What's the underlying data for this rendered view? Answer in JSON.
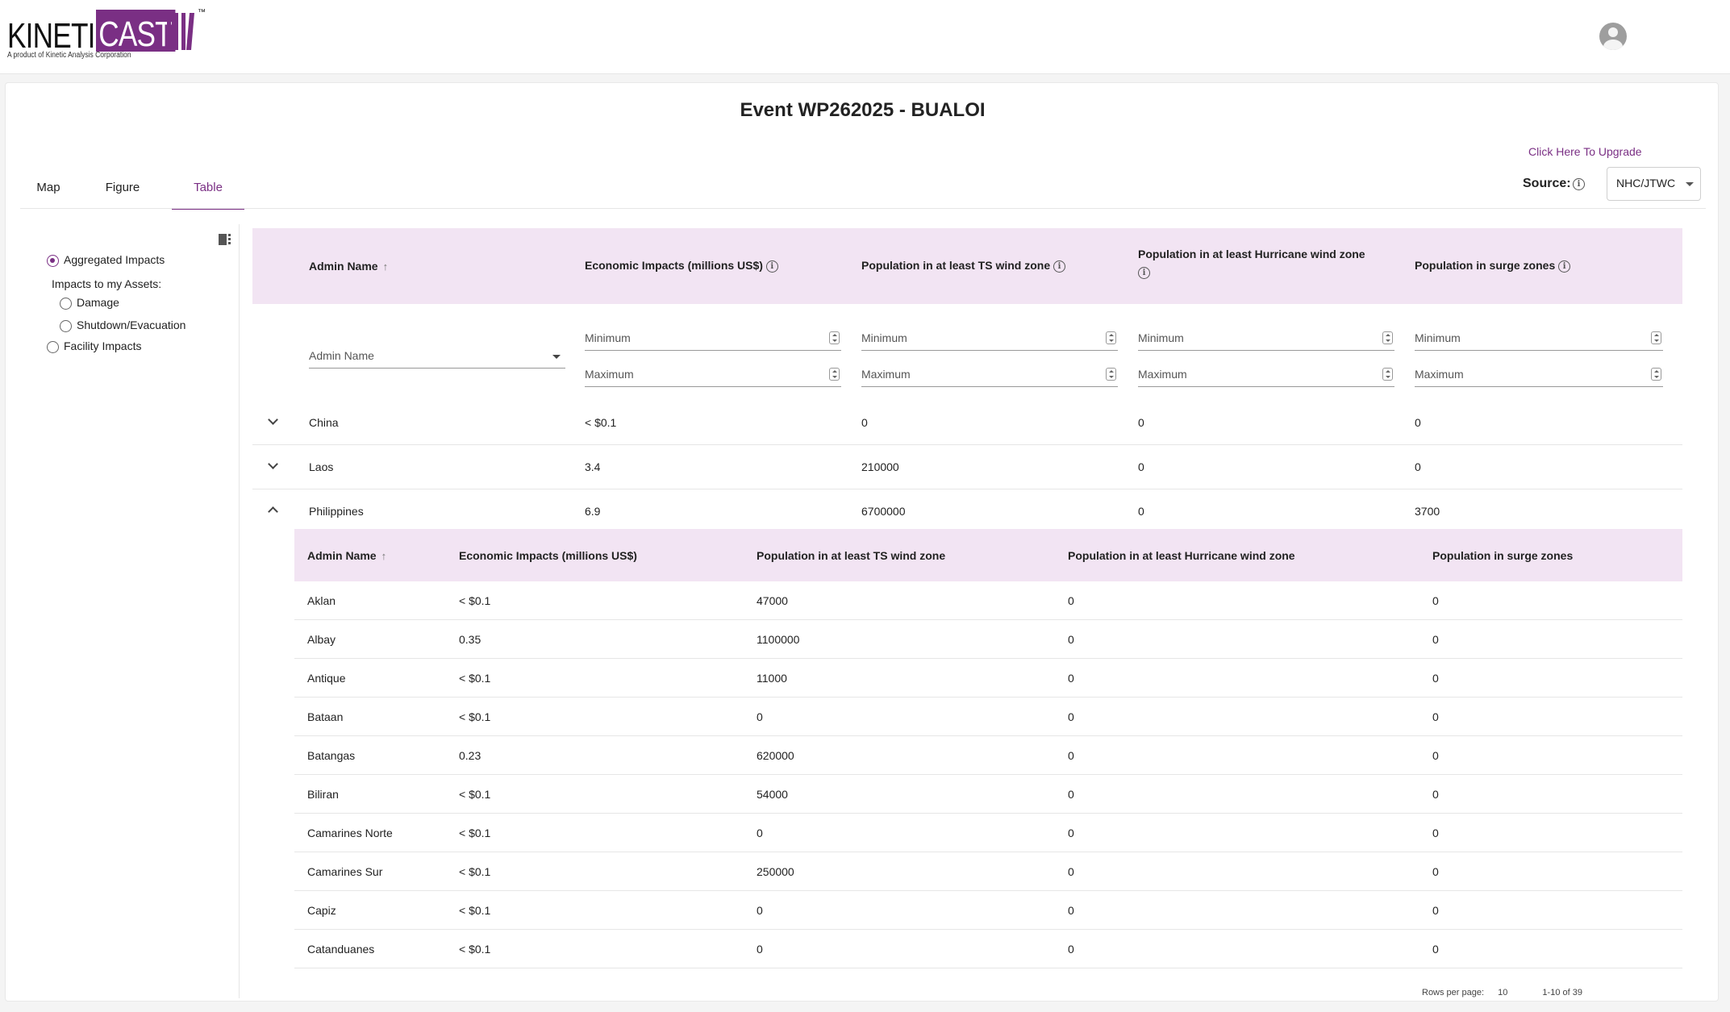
{
  "brand": {
    "name_left": "KINETI",
    "name_right": "CAST",
    "tm": "™",
    "tagline": "A product of Kinetic Analysis Corporation"
  },
  "page": {
    "title": "Event WP262025 - BUALOI",
    "upgrade_link": "Click Here To Upgrade"
  },
  "source": {
    "label": "Source:",
    "value": "NHC/JTWC"
  },
  "tabs": [
    {
      "label": "Map"
    },
    {
      "label": "Figure"
    },
    {
      "label": "Table"
    }
  ],
  "sidebar": {
    "aggregated": "Aggregated Impacts",
    "assets_label": "Impacts to my Assets:",
    "damage": "Damage",
    "shutdown": "Shutdown/Evacuation",
    "facility": "Facility Impacts"
  },
  "table": {
    "headers": {
      "admin": "Admin Name",
      "econ": "Economic Impacts (millions US$)",
      "ts": "Population in at least TS wind zone",
      "hurricane": "Population in at least Hurricane wind zone",
      "surge": "Population in surge zones"
    },
    "filters": {
      "admin_placeholder": "Admin Name",
      "min": "Minimum",
      "max": "Maximum"
    },
    "rows": [
      {
        "name": "China",
        "econ": "< $0.1",
        "ts": "0",
        "hurricane": "0",
        "surge": "0"
      },
      {
        "name": "Laos",
        "econ": "3.4",
        "ts": "210000",
        "hurricane": "0",
        "surge": "0"
      },
      {
        "name": "Philippines",
        "econ": "6.9",
        "ts": "6700000",
        "hurricane": "0",
        "surge": "3700"
      }
    ]
  },
  "subtable": {
    "headers": {
      "admin": "Admin Name",
      "econ": "Economic Impacts (millions US$)",
      "ts": "Population in at least TS wind zone",
      "hurricane": "Population in at least Hurricane wind zone",
      "surge": "Population in surge zones"
    },
    "rows": [
      {
        "name": "Aklan",
        "econ": "< $0.1",
        "ts": "47000",
        "hurricane": "0",
        "surge": "0"
      },
      {
        "name": "Albay",
        "econ": "0.35",
        "ts": "1100000",
        "hurricane": "0",
        "surge": "0"
      },
      {
        "name": "Antique",
        "econ": "< $0.1",
        "ts": "11000",
        "hurricane": "0",
        "surge": "0"
      },
      {
        "name": "Bataan",
        "econ": "< $0.1",
        "ts": "0",
        "hurricane": "0",
        "surge": "0"
      },
      {
        "name": "Batangas",
        "econ": "0.23",
        "ts": "620000",
        "hurricane": "0",
        "surge": "0"
      },
      {
        "name": "Biliran",
        "econ": "< $0.1",
        "ts": "54000",
        "hurricane": "0",
        "surge": "0"
      },
      {
        "name": "Camarines Norte",
        "econ": "< $0.1",
        "ts": "0",
        "hurricane": "0",
        "surge": "0"
      },
      {
        "name": "Camarines Sur",
        "econ": "< $0.1",
        "ts": "250000",
        "hurricane": "0",
        "surge": "0"
      },
      {
        "name": "Capiz",
        "econ": "< $0.1",
        "ts": "0",
        "hurricane": "0",
        "surge": "0"
      },
      {
        "name": "Catanduanes",
        "econ": "< $0.1",
        "ts": "0",
        "hurricane": "0",
        "surge": "0"
      }
    ],
    "pager": {
      "rows_label": "Rows per page:",
      "rows_value": "10",
      "range": "1-10 of 39"
    }
  }
}
